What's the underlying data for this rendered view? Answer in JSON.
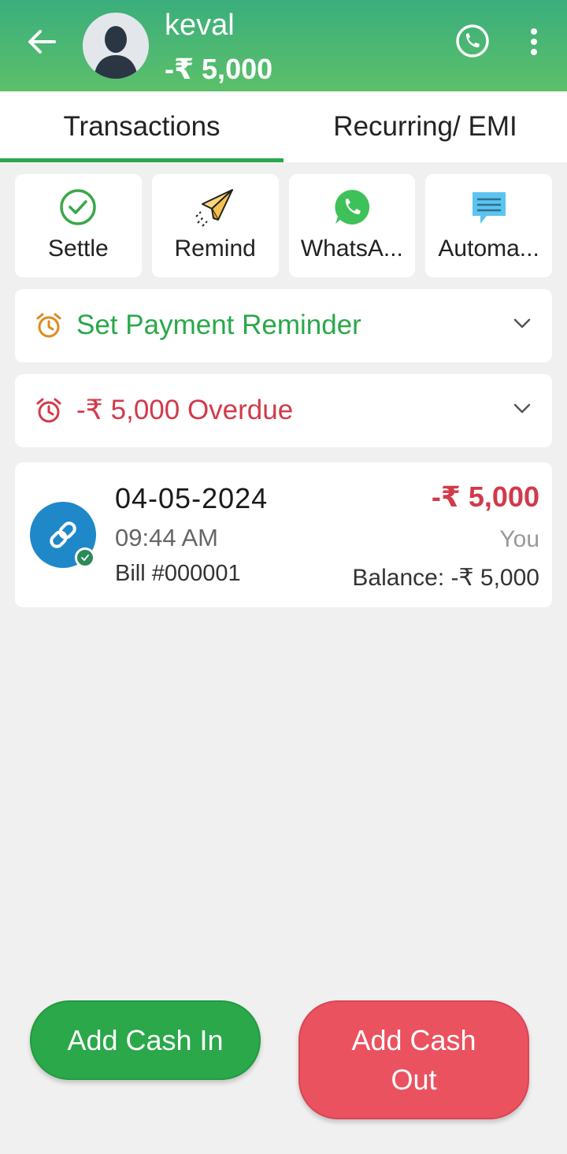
{
  "header": {
    "name": "keval",
    "balance": "-₹ 5,000"
  },
  "tabs": [
    {
      "label": "Transactions",
      "active": true
    },
    {
      "label": "Recurring/ EMI",
      "active": false
    }
  ],
  "actions": [
    {
      "label": "Settle",
      "icon": "check-circle-icon"
    },
    {
      "label": "Remind",
      "icon": "paper-plane-icon"
    },
    {
      "label": "WhatsA...",
      "icon": "whatsapp-icon"
    },
    {
      "label": "Automa...",
      "icon": "message-icon"
    }
  ],
  "reminder": {
    "label": "Set Payment Reminder",
    "color": "#2aa84a",
    "icon_color": "#e08a1e"
  },
  "overdue": {
    "label": "-₹ 5,000 Overdue",
    "color": "#d23a4a"
  },
  "transaction": {
    "date": "04-05-2024",
    "time": "09:44 AM",
    "bill": "Bill #000001",
    "amount": "-₹ 5,000",
    "by": "You",
    "balance": "Balance: -₹ 5,000"
  },
  "buttons": {
    "cash_in": "Add Cash In",
    "cash_out": "Add Cash Out"
  },
  "colors": {
    "header_start": "#3aae7c",
    "header_end": "#5cc06a",
    "cash_in": "#2aa84a",
    "cash_out": "#ea5260"
  }
}
